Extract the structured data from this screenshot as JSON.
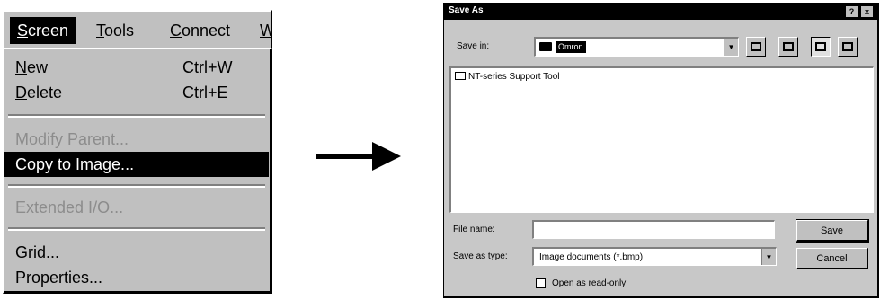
{
  "menubar": {
    "items": [
      {
        "label": "Screen",
        "active": true
      },
      {
        "label": "Tools"
      },
      {
        "label": "Connect"
      },
      {
        "label": "W"
      }
    ]
  },
  "screen_menu": {
    "items": [
      {
        "label": "New",
        "accelerator": "Ctrl+W"
      },
      {
        "label": "Delete",
        "accelerator": "Ctrl+E"
      },
      {
        "label": "Modify Parent...",
        "disabled": true
      },
      {
        "label": "Copy to Image...",
        "highlighted": true
      },
      {
        "label": "Extended I/O...",
        "disabled": true
      },
      {
        "label": "Grid..."
      },
      {
        "label": "Properties..."
      }
    ]
  },
  "dialog": {
    "title": "Save As",
    "titlebar_buttons": [
      "?",
      "x"
    ],
    "save_in_label": "Save in:",
    "save_in_value": "Omron",
    "files": [
      "NT-series Support Tool"
    ],
    "file_name_label": "File name:",
    "file_name_value": "",
    "save_as_type_label": "Save as type:",
    "save_as_type_value": "Image documents (*.bmp)",
    "save_button": "Save",
    "cancel_button": "Cancel",
    "read_only_label": "Open as read-only",
    "read_only_checked": false
  }
}
